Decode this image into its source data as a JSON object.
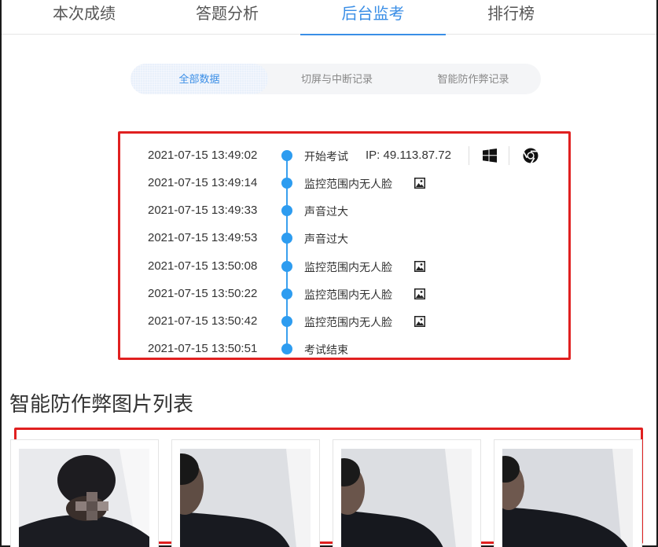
{
  "tabs": [
    {
      "label": "本次成绩",
      "active": false
    },
    {
      "label": "答题分析",
      "active": false
    },
    {
      "label": "后台监考",
      "active": true
    },
    {
      "label": "排行榜",
      "active": false
    }
  ],
  "filters": [
    {
      "label": "全部数据",
      "active": true
    },
    {
      "label": "切屏与中断记录",
      "active": false
    },
    {
      "label": "智能防作弊记录",
      "active": false
    }
  ],
  "timeline": [
    {
      "time": "2021-07-15 13:49:02",
      "text": "开始考试",
      "ip": "IP: 49.113.87.72",
      "os_icon": "windows-icon",
      "browser_icon": "chrome-icon"
    },
    {
      "time": "2021-07-15 13:49:14",
      "text": "监控范围内无人脸",
      "icon": "image-icon"
    },
    {
      "time": "2021-07-15 13:49:33",
      "text": "声音过大"
    },
    {
      "time": "2021-07-15 13:49:53",
      "text": "声音过大"
    },
    {
      "time": "2021-07-15 13:50:08",
      "text": "监控范围内无人脸",
      "icon": "image-icon"
    },
    {
      "time": "2021-07-15 13:50:22",
      "text": "监控范围内无人脸",
      "icon": "image-icon"
    },
    {
      "time": "2021-07-15 13:50:42",
      "text": "监控范围内无人脸",
      "icon": "image-icon"
    },
    {
      "time": "2021-07-15 13:50:51",
      "text": "考试结束"
    }
  ],
  "section": {
    "title": "智能防作弊图片列表"
  },
  "colors": {
    "accent": "#3a8ee6",
    "highlight_border": "#e02020",
    "timeline_dot": "#2d9cf0"
  }
}
